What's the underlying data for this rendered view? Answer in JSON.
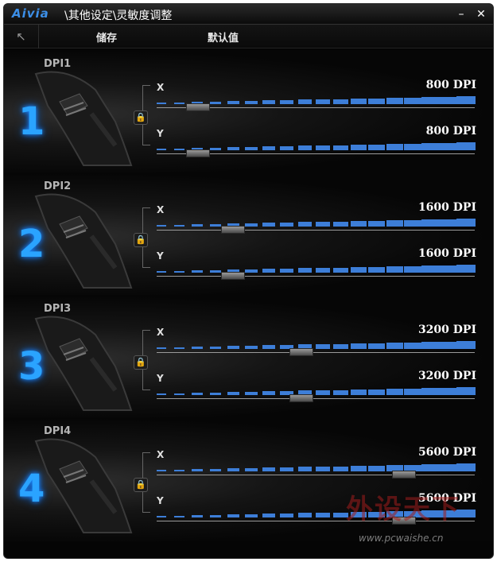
{
  "window": {
    "logo": "Aivia",
    "path": "\\其他设定\\灵敏度调整",
    "minimize": "–",
    "close": "✕"
  },
  "toolbar": {
    "back_icon": "↖",
    "save_label": "储存",
    "default_label": "默认值"
  },
  "axis_labels": {
    "x": "X",
    "y": "Y"
  },
  "lock_icon": "🔒",
  "profiles": [
    {
      "name": "DPI1",
      "number": "1",
      "x_dpi": "800 DPI",
      "y_dpi": "800 DPI",
      "x_level": 0.1,
      "y_level": 0.1
    },
    {
      "name": "DPI2",
      "number": "2",
      "x_dpi": "1600 DPI",
      "y_dpi": "1600 DPI",
      "x_level": 0.22,
      "y_level": 0.22
    },
    {
      "name": "DPI3",
      "number": "3",
      "x_dpi": "3200 DPI",
      "y_dpi": "3200 DPI",
      "x_level": 0.45,
      "y_level": 0.45
    },
    {
      "name": "DPI4",
      "number": "4",
      "x_dpi": "5600 DPI",
      "y_dpi": "5600 DPI",
      "x_level": 0.8,
      "y_level": 0.8
    }
  ],
  "watermark": {
    "cn": "外设天下",
    "url": "www.pcwaishe.cn"
  },
  "colors": {
    "accent": "#2aa3ff",
    "ladder": "#3d7ed8"
  }
}
